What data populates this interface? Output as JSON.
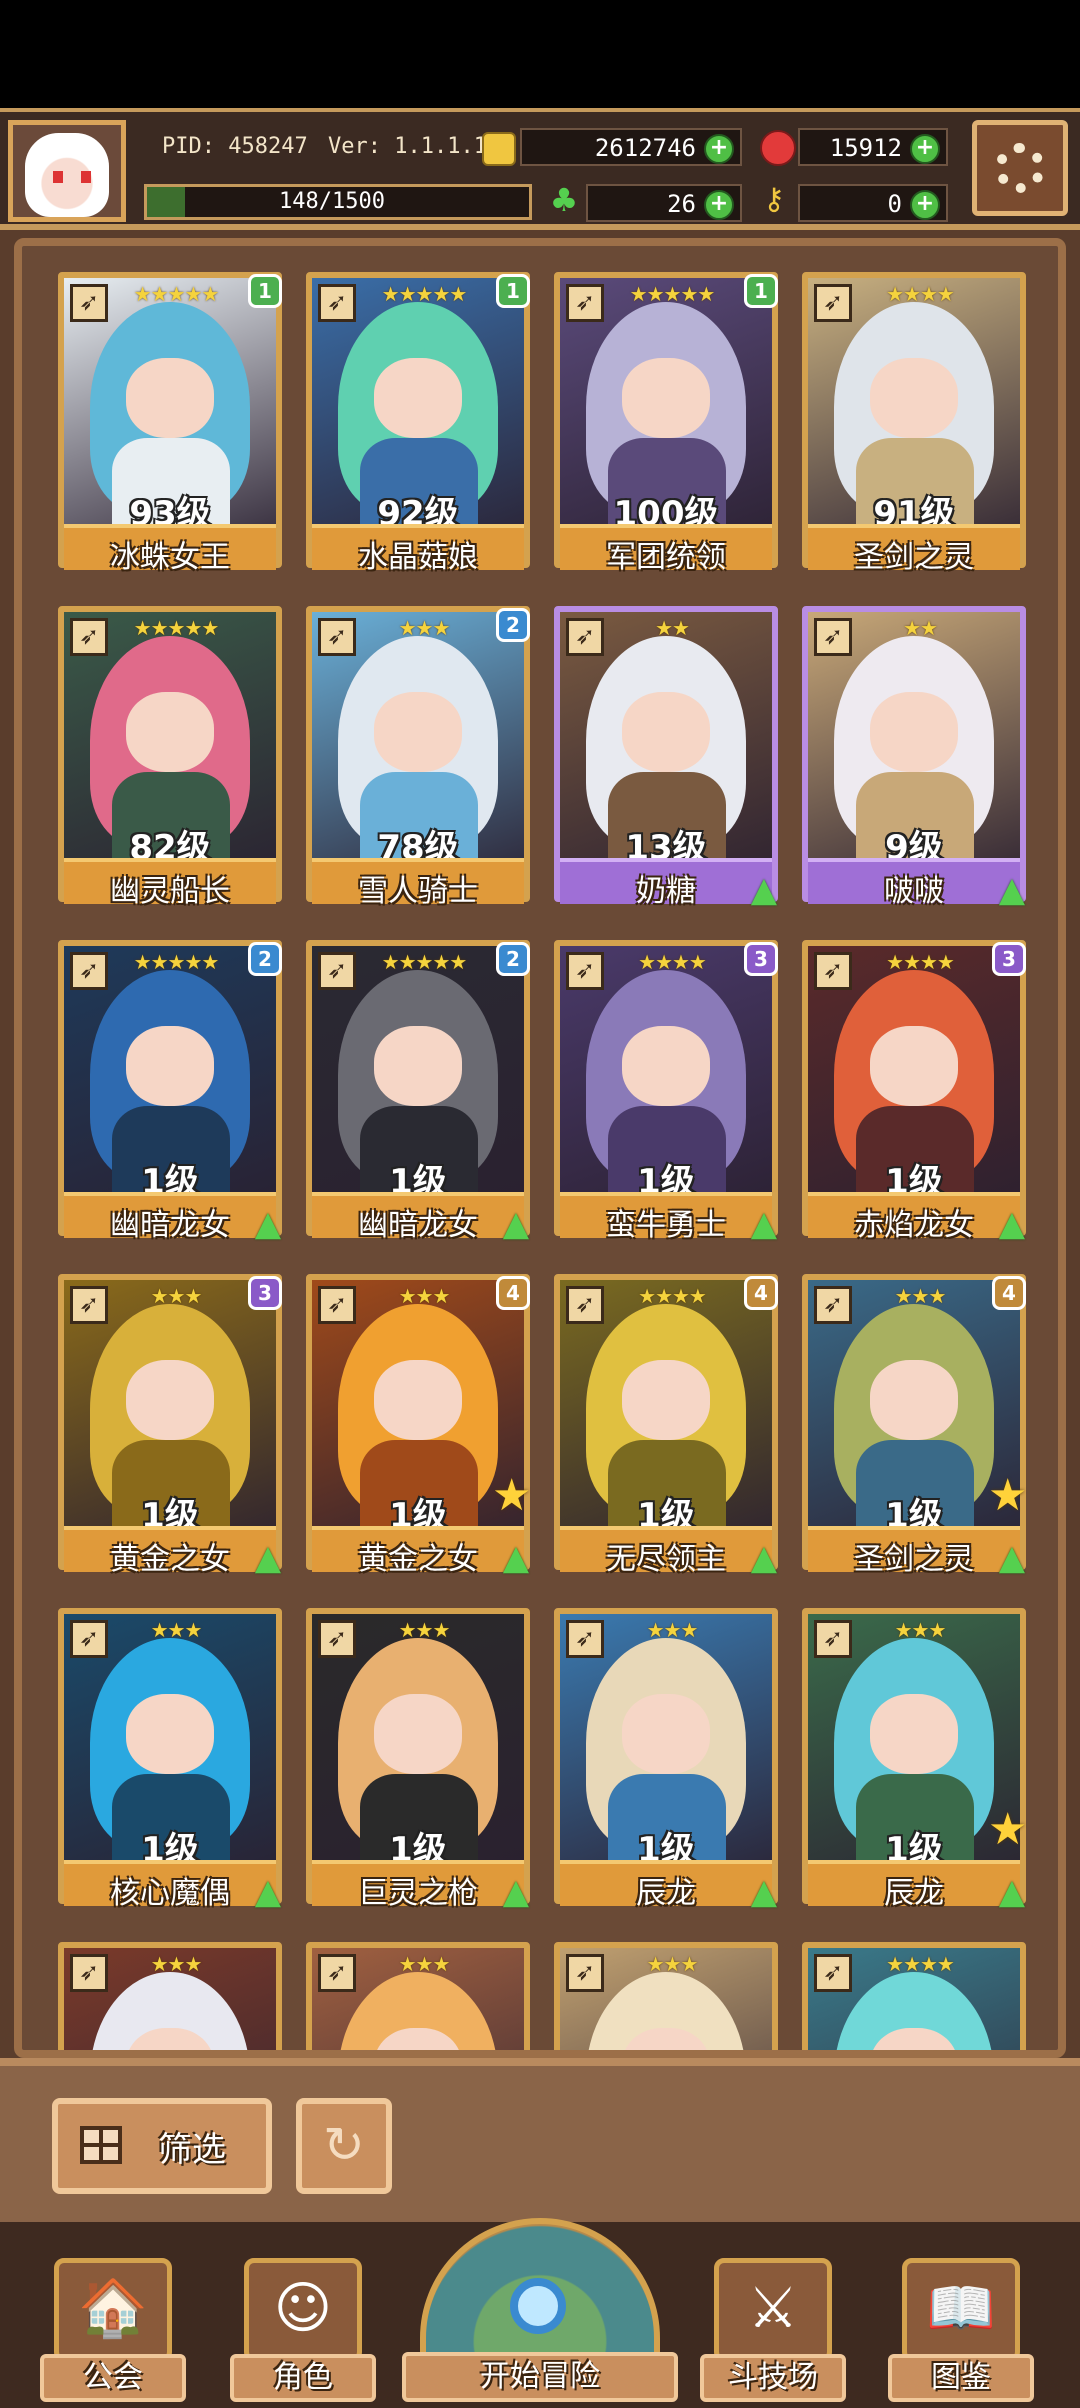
{
  "header": {
    "pid": "PID: 458247",
    "version": "Ver: 1.1.1.13",
    "gold": "2612746",
    "gems": "15912",
    "clover": "26",
    "keys": "0",
    "exp": "148/1500",
    "exp_progress": 0.0987
  },
  "cards": [
    {
      "name": "冰蛛女王",
      "level": "93级",
      "stars": "★★★★★",
      "badge": "1",
      "badge_color": "#4caf50",
      "hair": "#5fb8d8",
      "body": "#e8eef2",
      "frame": "gold",
      "upgrade": false,
      "big_star": false
    },
    {
      "name": "水晶菇娘",
      "level": "92级",
      "stars": "★★★★★",
      "badge": "1",
      "badge_color": "#4caf50",
      "hair": "#5fd0b0",
      "body": "#3a6ea8",
      "frame": "gold",
      "upgrade": false,
      "big_star": false
    },
    {
      "name": "军团统领",
      "level": "100级",
      "stars": "★★★★★",
      "badge": "1",
      "badge_color": "#4caf50",
      "hair": "#b7b2d6",
      "body": "#5a4a7a",
      "frame": "gold",
      "upgrade": false,
      "big_star": false
    },
    {
      "name": "圣剑之灵",
      "level": "91级",
      "stars": "★★★★",
      "badge": "",
      "badge_color": "",
      "hair": "#dfe4ea",
      "body": "#c8b080",
      "frame": "gold",
      "upgrade": false,
      "big_star": false
    },
    {
      "name": "幽灵船长",
      "level": "82级",
      "stars": "★★★★★",
      "badge": "",
      "badge_color": "",
      "hair": "#e06a8a",
      "body": "#3a5a48",
      "frame": "gold",
      "upgrade": false,
      "big_star": false
    },
    {
      "name": "雪人骑士",
      "level": "78级",
      "stars": "★★★",
      "badge": "2",
      "badge_color": "#3a8ad0",
      "hair": "#e0e8f0",
      "body": "#6ab0d8",
      "frame": "gold",
      "upgrade": false,
      "big_star": false
    },
    {
      "name": "奶糖",
      "level": "13级",
      "stars": "★★",
      "badge": "",
      "badge_color": "",
      "hair": "#e8eaf0",
      "body": "#7a5a40",
      "frame": "purple",
      "upgrade": true,
      "big_star": false
    },
    {
      "name": "啵啵",
      "level": "9级",
      "stars": "★★",
      "badge": "",
      "badge_color": "",
      "hair": "#eeeaf0",
      "body": "#c8a878",
      "frame": "purple",
      "upgrade": true,
      "big_star": false
    },
    {
      "name": "幽暗龙女",
      "level": "1级",
      "stars": "★★★★★",
      "badge": "2",
      "badge_color": "#3a8ad0",
      "hair": "#2e6ab0",
      "body": "#1e3a5a",
      "frame": "gold",
      "upgrade": true,
      "big_star": false
    },
    {
      "name": "幽暗龙女",
      "level": "1级",
      "stars": "★★★★★",
      "badge": "2",
      "badge_color": "#3a8ad0",
      "hair": "#6a6a72",
      "body": "#2a2a32",
      "frame": "gold",
      "upgrade": true,
      "big_star": false
    },
    {
      "name": "蛮牛勇士",
      "level": "1级",
      "stars": "★★★★",
      "badge": "3",
      "badge_color": "#8a5ac8",
      "hair": "#8a7ab8",
      "body": "#4a3a6a",
      "frame": "gold",
      "upgrade": true,
      "big_star": false
    },
    {
      "name": "赤焰龙女",
      "level": "1级",
      "stars": "★★★★",
      "badge": "3",
      "badge_color": "#8a5ac8",
      "hair": "#e0603a",
      "body": "#5a2a2a",
      "frame": "gold",
      "upgrade": true,
      "big_star": false
    },
    {
      "name": "黄金之女",
      "level": "1级",
      "stars": "★★★",
      "badge": "3",
      "badge_color": "#8a5ac8",
      "hair": "#d8b03a",
      "body": "#8a6a1a",
      "frame": "gold",
      "upgrade": true,
      "big_star": false
    },
    {
      "name": "黄金之女",
      "level": "1级",
      "stars": "★★★",
      "badge": "4",
      "badge_color": "#c08a3a",
      "hair": "#f0a030",
      "body": "#a04a1a",
      "frame": "gold",
      "upgrade": true,
      "big_star": true
    },
    {
      "name": "无尽领主",
      "level": "1级",
      "stars": "★★★★",
      "badge": "4",
      "badge_color": "#c08a3a",
      "hair": "#e0c040",
      "body": "#7a6a20",
      "frame": "gold",
      "upgrade": true,
      "big_star": false
    },
    {
      "name": "圣剑之灵",
      "level": "1级",
      "stars": "★★★",
      "badge": "4",
      "badge_color": "#c08a3a",
      "hair": "#a8b060",
      "body": "#3a6a88",
      "frame": "gold",
      "upgrade": true,
      "big_star": true
    },
    {
      "name": "核心魔偶",
      "level": "1级",
      "stars": "★★★",
      "badge": "",
      "badge_color": "",
      "hair": "#2aa8e0",
      "body": "#1a4a6a",
      "frame": "gold",
      "upgrade": true,
      "big_star": false
    },
    {
      "name": "巨灵之枪",
      "level": "1级",
      "stars": "★★★",
      "badge": "",
      "badge_color": "",
      "hair": "#e8b070",
      "body": "#2a2a2a",
      "frame": "gold",
      "upgrade": true,
      "big_star": false
    },
    {
      "name": "辰龙",
      "level": "1级",
      "stars": "★★★",
      "badge": "",
      "badge_color": "",
      "hair": "#e8d8b8",
      "body": "#3a7ab0",
      "frame": "gold",
      "upgrade": true,
      "big_star": false
    },
    {
      "name": "辰龙",
      "level": "1级",
      "stars": "★★★",
      "badge": "",
      "badge_color": "",
      "hair": "#60c8d8",
      "body": "#3a6a4a",
      "frame": "gold",
      "upgrade": true,
      "big_star": true
    },
    {
      "name": "",
      "level": "",
      "stars": "★★★",
      "badge": "",
      "badge_color": "",
      "hair": "#e8e8f0",
      "body": "#7a3a2a",
      "frame": "gold",
      "upgrade": false,
      "big_star": false
    },
    {
      "name": "",
      "level": "",
      "stars": "★★★",
      "badge": "",
      "badge_color": "",
      "hair": "#f0b060",
      "body": "#a06040",
      "frame": "gold",
      "upgrade": false,
      "big_star": false
    },
    {
      "name": "",
      "level": "",
      "stars": "★★★",
      "badge": "",
      "badge_color": "",
      "hair": "#f0e0c0",
      "body": "#c0a070",
      "frame": "gold",
      "upgrade": false,
      "big_star": false
    },
    {
      "name": "",
      "level": "",
      "stars": "★★★★",
      "badge": "",
      "badge_color": "",
      "hair": "#70d8d8",
      "body": "#3a7a8a",
      "frame": "gold",
      "upgrade": false,
      "big_star": false
    }
  ],
  "filter": {
    "filter_label": "筛选"
  },
  "nav": {
    "guild": "公会",
    "character": "角色",
    "adventure": "开始冒险",
    "arena": "斗技场",
    "codex": "图鉴"
  }
}
